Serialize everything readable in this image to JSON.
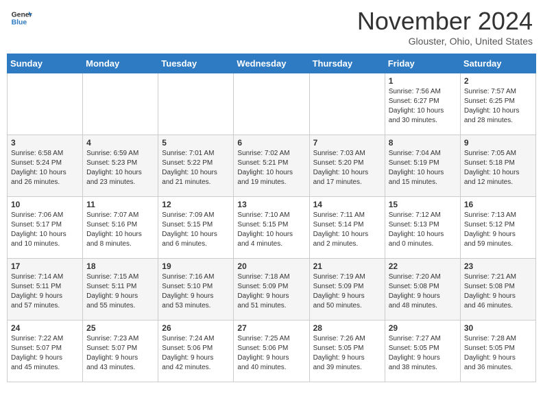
{
  "header": {
    "logo_line1": "General",
    "logo_line2": "Blue",
    "month_title": "November 2024",
    "location": "Glouster, Ohio, United States"
  },
  "weekdays": [
    "Sunday",
    "Monday",
    "Tuesday",
    "Wednesday",
    "Thursday",
    "Friday",
    "Saturday"
  ],
  "weeks": [
    [
      {
        "day": "",
        "info": ""
      },
      {
        "day": "",
        "info": ""
      },
      {
        "day": "",
        "info": ""
      },
      {
        "day": "",
        "info": ""
      },
      {
        "day": "",
        "info": ""
      },
      {
        "day": "1",
        "info": "Sunrise: 7:56 AM\nSunset: 6:27 PM\nDaylight: 10 hours\nand 30 minutes."
      },
      {
        "day": "2",
        "info": "Sunrise: 7:57 AM\nSunset: 6:25 PM\nDaylight: 10 hours\nand 28 minutes."
      }
    ],
    [
      {
        "day": "3",
        "info": "Sunrise: 6:58 AM\nSunset: 5:24 PM\nDaylight: 10 hours\nand 26 minutes."
      },
      {
        "day": "4",
        "info": "Sunrise: 6:59 AM\nSunset: 5:23 PM\nDaylight: 10 hours\nand 23 minutes."
      },
      {
        "day": "5",
        "info": "Sunrise: 7:01 AM\nSunset: 5:22 PM\nDaylight: 10 hours\nand 21 minutes."
      },
      {
        "day": "6",
        "info": "Sunrise: 7:02 AM\nSunset: 5:21 PM\nDaylight: 10 hours\nand 19 minutes."
      },
      {
        "day": "7",
        "info": "Sunrise: 7:03 AM\nSunset: 5:20 PM\nDaylight: 10 hours\nand 17 minutes."
      },
      {
        "day": "8",
        "info": "Sunrise: 7:04 AM\nSunset: 5:19 PM\nDaylight: 10 hours\nand 15 minutes."
      },
      {
        "day": "9",
        "info": "Sunrise: 7:05 AM\nSunset: 5:18 PM\nDaylight: 10 hours\nand 12 minutes."
      }
    ],
    [
      {
        "day": "10",
        "info": "Sunrise: 7:06 AM\nSunset: 5:17 PM\nDaylight: 10 hours\nand 10 minutes."
      },
      {
        "day": "11",
        "info": "Sunrise: 7:07 AM\nSunset: 5:16 PM\nDaylight: 10 hours\nand 8 minutes."
      },
      {
        "day": "12",
        "info": "Sunrise: 7:09 AM\nSunset: 5:15 PM\nDaylight: 10 hours\nand 6 minutes."
      },
      {
        "day": "13",
        "info": "Sunrise: 7:10 AM\nSunset: 5:15 PM\nDaylight: 10 hours\nand 4 minutes."
      },
      {
        "day": "14",
        "info": "Sunrise: 7:11 AM\nSunset: 5:14 PM\nDaylight: 10 hours\nand 2 minutes."
      },
      {
        "day": "15",
        "info": "Sunrise: 7:12 AM\nSunset: 5:13 PM\nDaylight: 10 hours\nand 0 minutes."
      },
      {
        "day": "16",
        "info": "Sunrise: 7:13 AM\nSunset: 5:12 PM\nDaylight: 9 hours\nand 59 minutes."
      }
    ],
    [
      {
        "day": "17",
        "info": "Sunrise: 7:14 AM\nSunset: 5:11 PM\nDaylight: 9 hours\nand 57 minutes."
      },
      {
        "day": "18",
        "info": "Sunrise: 7:15 AM\nSunset: 5:11 PM\nDaylight: 9 hours\nand 55 minutes."
      },
      {
        "day": "19",
        "info": "Sunrise: 7:16 AM\nSunset: 5:10 PM\nDaylight: 9 hours\nand 53 minutes."
      },
      {
        "day": "20",
        "info": "Sunrise: 7:18 AM\nSunset: 5:09 PM\nDaylight: 9 hours\nand 51 minutes."
      },
      {
        "day": "21",
        "info": "Sunrise: 7:19 AM\nSunset: 5:09 PM\nDaylight: 9 hours\nand 50 minutes."
      },
      {
        "day": "22",
        "info": "Sunrise: 7:20 AM\nSunset: 5:08 PM\nDaylight: 9 hours\nand 48 minutes."
      },
      {
        "day": "23",
        "info": "Sunrise: 7:21 AM\nSunset: 5:08 PM\nDaylight: 9 hours\nand 46 minutes."
      }
    ],
    [
      {
        "day": "24",
        "info": "Sunrise: 7:22 AM\nSunset: 5:07 PM\nDaylight: 9 hours\nand 45 minutes."
      },
      {
        "day": "25",
        "info": "Sunrise: 7:23 AM\nSunset: 5:07 PM\nDaylight: 9 hours\nand 43 minutes."
      },
      {
        "day": "26",
        "info": "Sunrise: 7:24 AM\nSunset: 5:06 PM\nDaylight: 9 hours\nand 42 minutes."
      },
      {
        "day": "27",
        "info": "Sunrise: 7:25 AM\nSunset: 5:06 PM\nDaylight: 9 hours\nand 40 minutes."
      },
      {
        "day": "28",
        "info": "Sunrise: 7:26 AM\nSunset: 5:05 PM\nDaylight: 9 hours\nand 39 minutes."
      },
      {
        "day": "29",
        "info": "Sunrise: 7:27 AM\nSunset: 5:05 PM\nDaylight: 9 hours\nand 38 minutes."
      },
      {
        "day": "30",
        "info": "Sunrise: 7:28 AM\nSunset: 5:05 PM\nDaylight: 9 hours\nand 36 minutes."
      }
    ]
  ]
}
